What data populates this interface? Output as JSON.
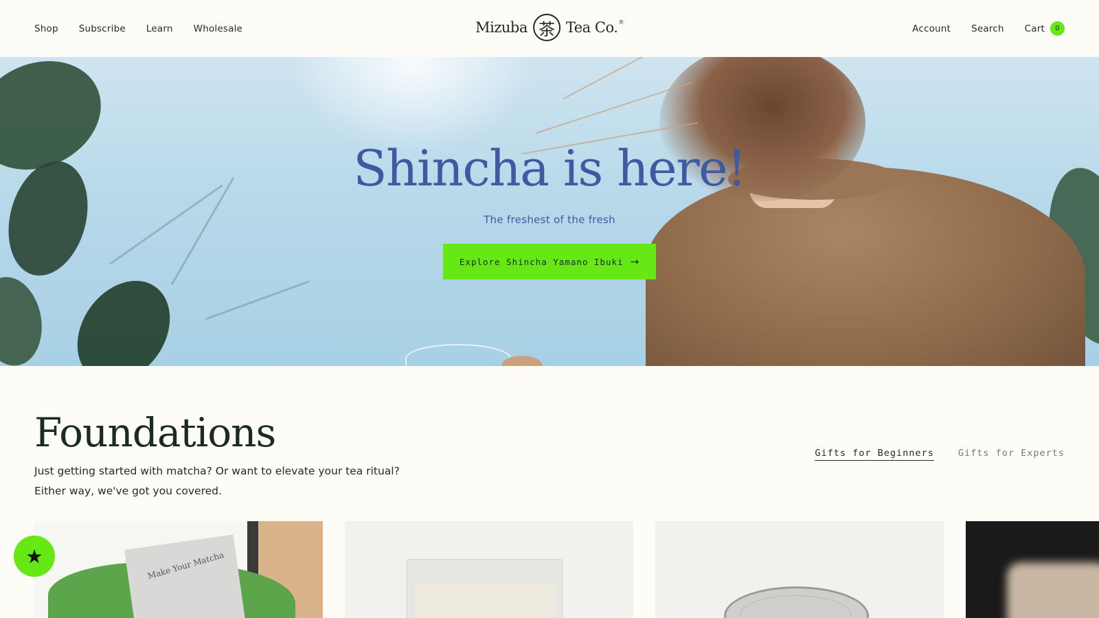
{
  "nav": {
    "left": [
      {
        "label": "Shop"
      },
      {
        "label": "Subscribe"
      },
      {
        "label": "Learn"
      },
      {
        "label": "Wholesale"
      }
    ],
    "right": {
      "account": "Account",
      "search": "Search",
      "cart": "Cart",
      "cart_count": "0"
    }
  },
  "logo": {
    "left": "Mizuba",
    "seal": "茶",
    "right": "Tea Co.",
    "reg": "®"
  },
  "hero": {
    "title": "Shincha is here!",
    "subtitle": "The freshest of the fresh",
    "cta_label": "Explore Shincha Yamano Ibuki",
    "cta_icon": "→"
  },
  "foundations": {
    "title": "Foundations",
    "description_line1": "Just getting started with matcha? Or want to elevate your tea ritual?",
    "description_line2": "Either way, we've got you covered.",
    "tabs": [
      {
        "label": "Gifts for Beginners",
        "active": true
      },
      {
        "label": "Gifts for Experts",
        "active": false
      }
    ]
  },
  "cards": {
    "card1_text": "Make Your Matcha"
  },
  "rewards": {
    "icon": "★"
  },
  "colors": {
    "accent": "#65e814",
    "hero_text": "#3e5aa0",
    "background": "#fdfcf7"
  }
}
